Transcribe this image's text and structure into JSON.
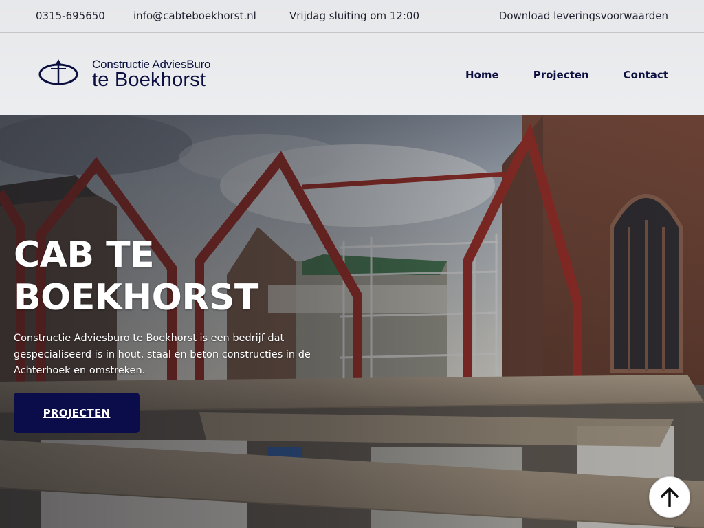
{
  "topbar": {
    "phone": "0315-695650",
    "email": "info@cabteboekhorst.nl",
    "hours": "Vrijdag sluiting om 12:00",
    "download": "Download leveringsvoorwaarden"
  },
  "logo": {
    "line1": "Constructie AdviesBuro",
    "line2": "te Boekhorst"
  },
  "nav": {
    "items": [
      {
        "label": "Home"
      },
      {
        "label": "Projecten"
      },
      {
        "label": "Contact"
      }
    ]
  },
  "hero": {
    "title_line1": "CAB TE",
    "title_line2": "BOEKHORST",
    "description": "Constructie Adviesburo te Boekhorst is een bedrijf dat gespecialiseerd is in hout, staal en beton constructies in de Achterhoek en omstreken.",
    "button_label": "PROJECTEN"
  },
  "icons": {
    "scroll_top": "arrow-up-icon"
  },
  "colors": {
    "brand_navy": "#0b0d4a",
    "steel_red": "#8a2a24"
  }
}
